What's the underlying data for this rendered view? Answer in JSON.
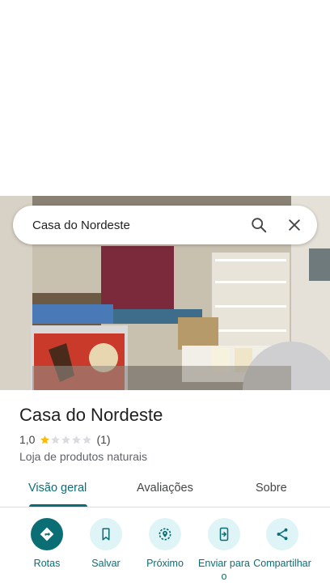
{
  "search": {
    "query": "Casa do Nordeste"
  },
  "place": {
    "name": "Casa do Nordeste",
    "rating": "1,0",
    "rating_value": 1,
    "review_count": "(1)",
    "category": "Loja de produtos naturais"
  },
  "tabs": [
    {
      "label": "Visão geral",
      "active": true
    },
    {
      "label": "Avaliações",
      "active": false
    },
    {
      "label": "Sobre",
      "active": false
    }
  ],
  "actions": [
    {
      "label": "Rotas",
      "icon": "directions-icon"
    },
    {
      "label": "Salvar",
      "icon": "bookmark-icon"
    },
    {
      "label": "Próximo",
      "icon": "nearby-icon"
    },
    {
      "label": "Enviar para o",
      "icon": "send-to-phone-icon"
    },
    {
      "label": "Compartilhar",
      "icon": "share-icon"
    }
  ],
  "colors": {
    "accent": "#0b6e75",
    "accent_light": "#dff4f6",
    "star_filled": "#fbbc04",
    "star_empty": "#dadce0"
  }
}
